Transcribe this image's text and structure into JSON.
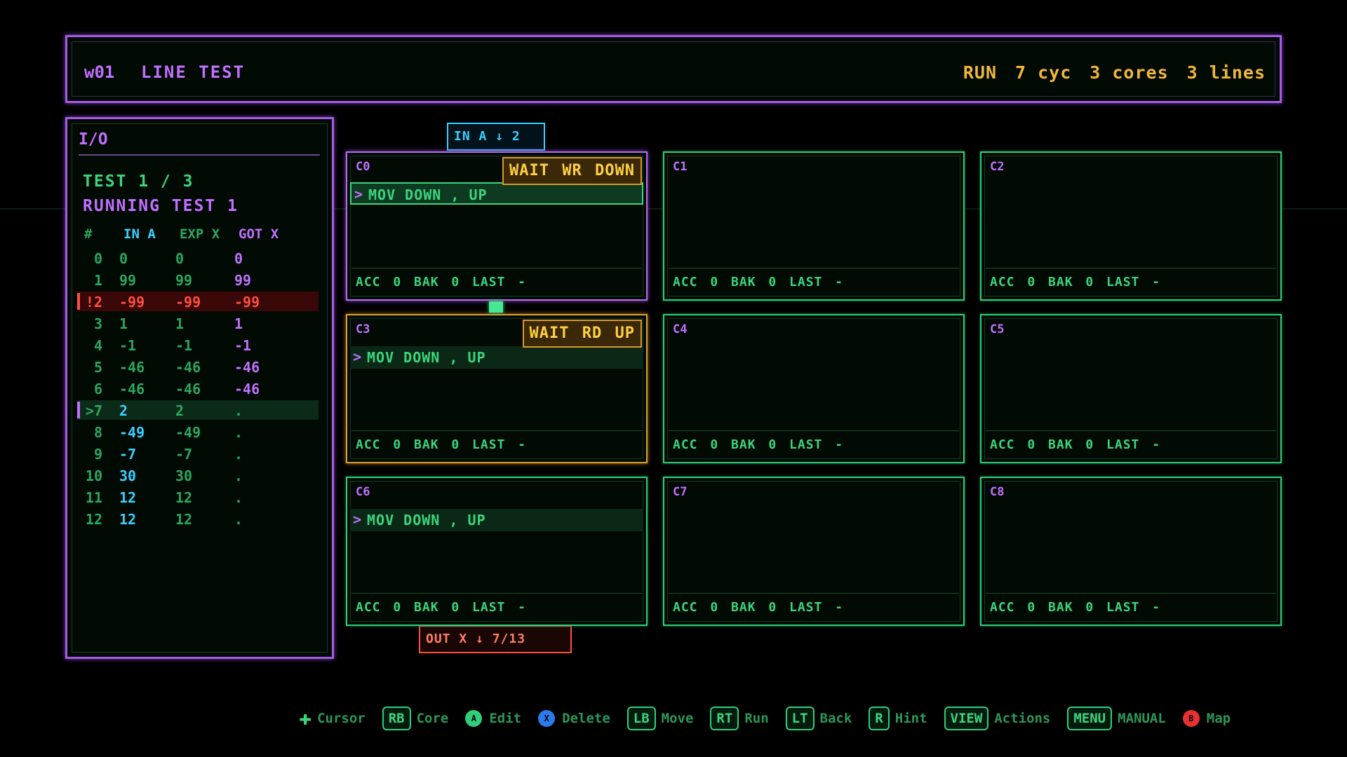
{
  "header": {
    "level_id": "w01",
    "title": "LINE TEST",
    "stats": [
      "RUN",
      "7 cyc",
      "3 cores",
      "3 lines"
    ]
  },
  "io": {
    "title": "I/O",
    "test_progress": "TEST 1 / 3",
    "running": "RUNNING TEST 1",
    "columns": [
      "#",
      "IN A",
      "EXP X",
      "GOT X"
    ],
    "rows": [
      {
        "idx": "0",
        "in": "0",
        "exp": "0",
        "got": "0",
        "state": "done"
      },
      {
        "idx": "1",
        "in": "99",
        "exp": "99",
        "got": "99",
        "state": "done"
      },
      {
        "idx": "!2",
        "in": "-99",
        "exp": "-99",
        "got": "-99",
        "state": "error"
      },
      {
        "idx": "3",
        "in": "1",
        "exp": "1",
        "got": "1",
        "state": "done"
      },
      {
        "idx": "4",
        "in": "-1",
        "exp": "-1",
        "got": "-1",
        "state": "done"
      },
      {
        "idx": "5",
        "in": "-46",
        "exp": "-46",
        "got": "-46",
        "state": "done"
      },
      {
        "idx": "6",
        "in": "-46",
        "exp": "-46",
        "got": "-46",
        "state": "done"
      },
      {
        "idx": ">7",
        "in": "2",
        "exp": "2",
        "got": ".",
        "state": "current"
      },
      {
        "idx": "8",
        "in": "-49",
        "exp": "-49",
        "got": ".",
        "state": "pending"
      },
      {
        "idx": "9",
        "in": "-7",
        "exp": "-7",
        "got": ".",
        "state": "pending"
      },
      {
        "idx": "10",
        "in": "30",
        "exp": "30",
        "got": ".",
        "state": "pending"
      },
      {
        "idx": "11",
        "in": "12",
        "exp": "12",
        "got": ".",
        "state": "pending"
      },
      {
        "idx": "12",
        "in": "12",
        "exp": "12",
        "got": ".",
        "state": "pending"
      }
    ]
  },
  "ports": {
    "in": "IN A ↓ 2",
    "out": "OUT X ↓  7/13"
  },
  "cores": [
    {
      "id": "C0",
      "code": "MOV  DOWN , UP",
      "status": "WAIT WR DOWN",
      "regs": "ACC 0  BAK 0  LAST -",
      "state": "active"
    },
    {
      "id": "C1",
      "code": "",
      "status": "",
      "regs": "ACC 0  BAK 0  LAST -",
      "state": "idle"
    },
    {
      "id": "C2",
      "code": "",
      "status": "",
      "regs": "ACC 0  BAK 0  LAST -",
      "state": "idle"
    },
    {
      "id": "C3",
      "code": "MOV  DOWN , UP",
      "status": "WAIT RD UP",
      "regs": "ACC 0  BAK 0  LAST -",
      "state": "waiting"
    },
    {
      "id": "C4",
      "code": "",
      "status": "",
      "regs": "ACC 0  BAK 0  LAST -",
      "state": "idle"
    },
    {
      "id": "C5",
      "code": "",
      "status": "",
      "regs": "ACC 0  BAK 0  LAST -",
      "state": "idle"
    },
    {
      "id": "C6",
      "code": "MOV  DOWN , UP",
      "status": "",
      "regs": "ACC 0  BAK 0  LAST -",
      "state": "idle"
    },
    {
      "id": "C7",
      "code": "",
      "status": "",
      "regs": "ACC 0  BAK 0  LAST -",
      "state": "idle"
    },
    {
      "id": "C8",
      "code": "",
      "status": "",
      "regs": "ACC 0  BAK 0  LAST -",
      "state": "idle"
    }
  ],
  "controls": [
    {
      "button": "✚",
      "kind": "dpad",
      "label": "Cursor"
    },
    {
      "button": "RB",
      "kind": "badge",
      "label": "Core"
    },
    {
      "button": "A",
      "kind": "dot",
      "color": "#2fcf7a",
      "label": "Edit"
    },
    {
      "button": "X",
      "kind": "dot",
      "color": "#2a7ae8",
      "label": "Delete"
    },
    {
      "button": "LB",
      "kind": "badge",
      "label": "Move"
    },
    {
      "button": "RT",
      "kind": "badge",
      "label": "Run"
    },
    {
      "button": "LT",
      "kind": "badge",
      "label": "Back"
    },
    {
      "button": "R",
      "kind": "badge",
      "label": "Hint"
    },
    {
      "button": "VIEW",
      "kind": "badge",
      "label": "Actions"
    },
    {
      "button": "MENU",
      "kind": "badge",
      "label": "MANUAL"
    },
    {
      "button": "B",
      "kind": "dot",
      "color": "#e83030",
      "label": "Map"
    }
  ],
  "colors": {
    "frame": "#a45be6",
    "core_border": "#2fcf7a",
    "waiting": "#e0a030",
    "error": "#ff5040",
    "input": "#3ad0ff"
  }
}
